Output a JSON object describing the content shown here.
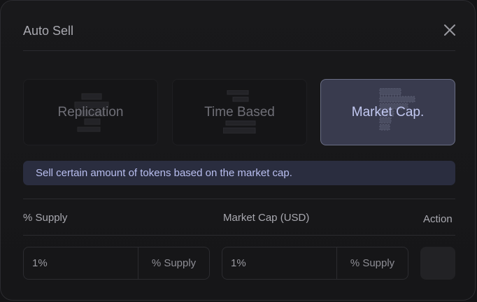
{
  "modal": {
    "title": "Auto Sell",
    "close_icon": "close-icon"
  },
  "modes": [
    {
      "label": "Replication",
      "selected": false
    },
    {
      "label": "Time Based",
      "selected": false
    },
    {
      "label": "Market Cap.",
      "selected": true
    }
  ],
  "info_text": "Sell certain amount of tokens based on the market cap.",
  "table": {
    "headers": [
      "% Supply",
      "Market Cap (USD)",
      "Action"
    ],
    "row": {
      "supply_value": "1%",
      "supply_unit": "% Supply",
      "mcap_value": "1%",
      "mcap_unit": "% Supply"
    }
  },
  "colors": {
    "background": "#141416",
    "selected_card": "#393b4e",
    "accent_text": "#c3c9f2",
    "info_bg": "#2a2d3f"
  }
}
